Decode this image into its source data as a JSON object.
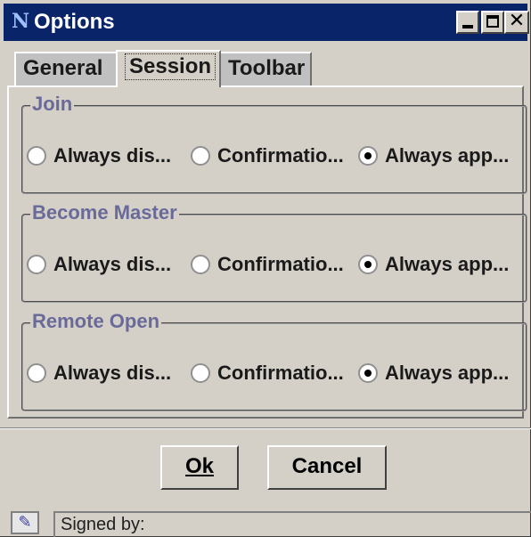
{
  "window": {
    "title": "Options",
    "app_icon": "N",
    "close_glyph": "✕"
  },
  "tabs": [
    {
      "label": "General",
      "selected": false
    },
    {
      "label": "Session",
      "selected": true
    },
    {
      "label": "Toolbar",
      "selected": false
    }
  ],
  "groups": [
    {
      "title": "Join",
      "options": [
        {
          "label": "Always dis...",
          "checked": false
        },
        {
          "label": "Confirmatio...",
          "checked": false
        },
        {
          "label": "Always app...",
          "checked": true
        }
      ]
    },
    {
      "title": "Become Master",
      "options": [
        {
          "label": "Always dis...",
          "checked": false
        },
        {
          "label": "Confirmatio...",
          "checked": false
        },
        {
          "label": "Always app...",
          "checked": true
        }
      ]
    },
    {
      "title": "Remote Open",
      "options": [
        {
          "label": "Always dis...",
          "checked": false
        },
        {
          "label": "Confirmatio...",
          "checked": false
        },
        {
          "label": "Always app...",
          "checked": true
        }
      ]
    }
  ],
  "buttons": {
    "ok_label": "Ok",
    "cancel_label": "Cancel"
  },
  "status": {
    "icon": "certificate-icon",
    "text": "Signed by:"
  },
  "colors": {
    "titlebar": "#0a246a",
    "face": "#d4d0c8",
    "group_title": "#6a6a9a"
  }
}
